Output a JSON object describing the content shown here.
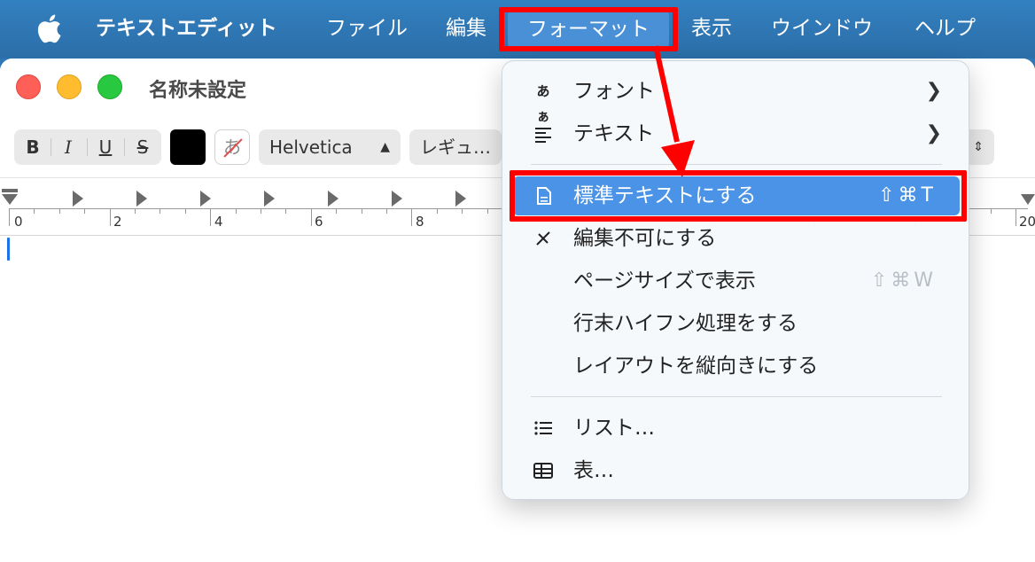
{
  "menubar": {
    "app_name": "テキストエディット",
    "items": [
      "ファイル",
      "編集",
      "フォーマット",
      "表示",
      "ウインドウ",
      "ヘルプ"
    ],
    "selected": "フォーマット"
  },
  "window": {
    "title": "名称未設定"
  },
  "toolbar": {
    "bold": "B",
    "italic": "I",
    "underline": "U",
    "strike": "S",
    "highlight_glyph": "あ",
    "font_family": "Helvetica",
    "font_style": "レギュ…"
  },
  "ruler": {
    "labels": [
      "0",
      "2",
      "4",
      "6",
      "8",
      "20"
    ]
  },
  "format_menu": {
    "items": [
      {
        "label": "フォント",
        "icon": "font-aa-icon",
        "icon_text": "あぁ",
        "submenu": true
      },
      {
        "label": "テキスト",
        "icon": "text-align-icon",
        "submenu": true
      },
      {
        "label": "標準テキストにする",
        "icon": "document-icon",
        "shortcut": "⇧⌘T",
        "highlighted": true
      },
      {
        "label": "編集不可にする",
        "icon": "pencil-slash-icon"
      },
      {
        "label": "ページサイズで表示",
        "shortcut": "⇧⌘W",
        "shortcut_disabled": true
      },
      {
        "label": "行末ハイフン処理をする"
      },
      {
        "label": "レイアウトを縦向きにする"
      },
      {
        "label": "リスト…",
        "icon": "list-icon"
      },
      {
        "label": "表…",
        "icon": "table-icon"
      }
    ]
  },
  "colors": {
    "menubar": "#2f77b6",
    "highlight": "#4b93e6",
    "annotation": "#ff0000"
  }
}
